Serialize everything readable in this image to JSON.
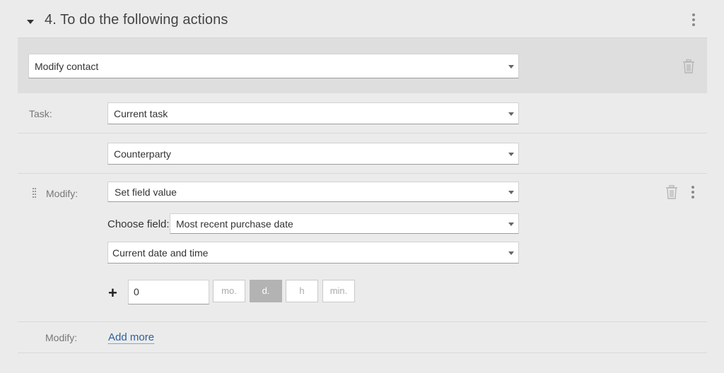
{
  "section": {
    "title": "4. To do the following actions"
  },
  "action": {
    "selected": "Modify contact"
  },
  "task_row": {
    "label": "Task:",
    "selected": "Current task"
  },
  "target_row": {
    "selected": "Counterparty"
  },
  "modify_row": {
    "label": "Modify:",
    "mode": "Set field value",
    "choose_field_label": "Choose field:",
    "field": "Most recent purchase date",
    "value_source": "Current date and time",
    "plus_sign": "+",
    "offset_value": "0",
    "units": [
      "mo.",
      "d.",
      "h",
      "min."
    ],
    "active_unit": "d."
  },
  "add_row": {
    "label": "Modify:",
    "add_more": "Add more"
  },
  "icons": {
    "collapse": "caret-down-icon",
    "menu": "kebab-menu-icon",
    "delete": "trash-icon",
    "drag": "drag-handle-icon",
    "dropdown": "chevron-down-icon"
  },
  "colors": {
    "link": "#2c5f9e",
    "active_unit_bg": "#b3b3b3",
    "panel_bg": "#ebebeb",
    "action_block_bg": "#dedede"
  }
}
